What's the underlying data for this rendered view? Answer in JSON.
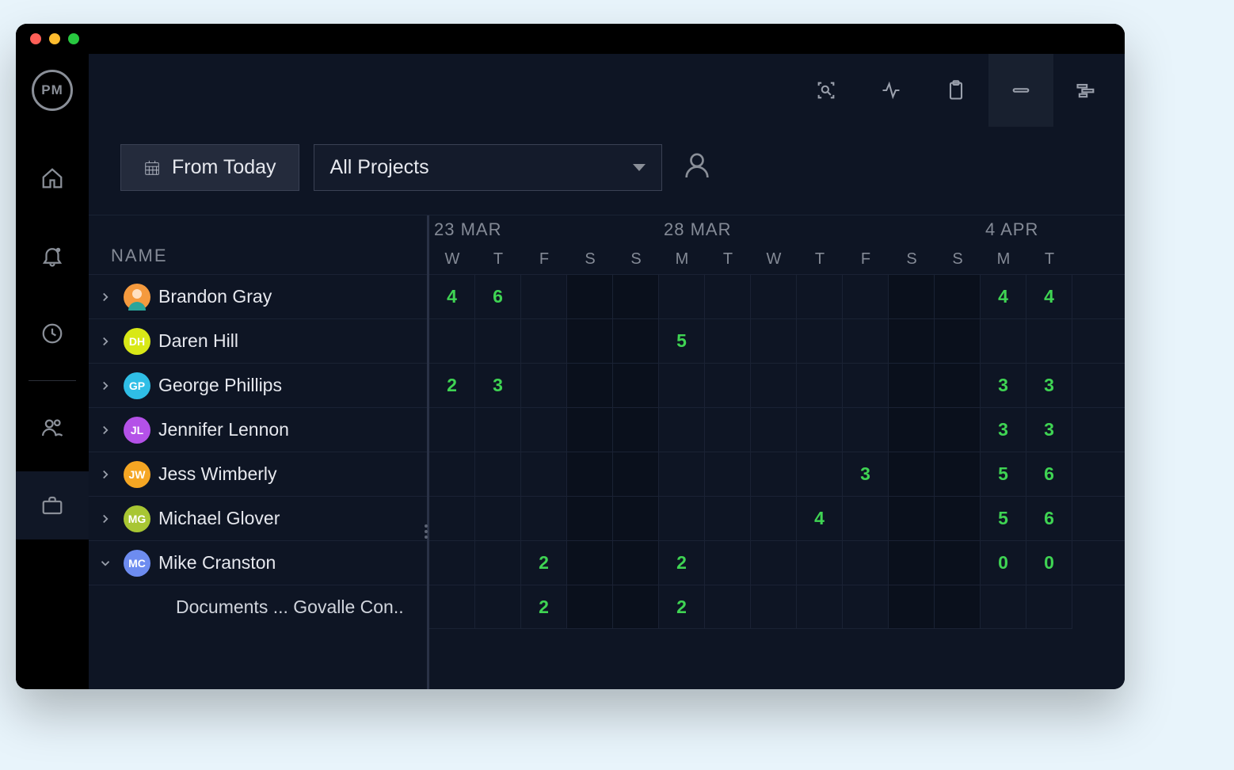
{
  "logo_text": "PM",
  "toolbar": {
    "from_today_label": "From Today",
    "projects_select_label": "All Projects"
  },
  "name_header": "NAME",
  "week_labels": [
    "23 MAR",
    "28 MAR",
    "4 APR"
  ],
  "week_spans": [
    5,
    7,
    2
  ],
  "days": [
    "W",
    "T",
    "F",
    "S",
    "S",
    "M",
    "T",
    "W",
    "T",
    "F",
    "S",
    "S",
    "M",
    "T"
  ],
  "weekend_idx": [
    3,
    4,
    10,
    11
  ],
  "people": [
    {
      "name": "Brandon Gray",
      "initials": "",
      "avatar_color": "#f59a3e",
      "avatar_img": true,
      "expanded": false,
      "cells": [
        "4",
        "6",
        "",
        "",
        "",
        "",
        "",
        "",
        "",
        "",
        "",
        "",
        "4",
        "4"
      ]
    },
    {
      "name": "Daren Hill",
      "initials": "DH",
      "avatar_color": "#d8e817",
      "avatar_img": false,
      "expanded": false,
      "cells": [
        "",
        "",
        "",
        "",
        "",
        "5",
        "",
        "",
        "",
        "",
        "",
        "",
        "",
        ""
      ]
    },
    {
      "name": "George Phillips",
      "initials": "GP",
      "avatar_color": "#2fbee6",
      "avatar_img": false,
      "expanded": false,
      "cells": [
        "2",
        "3",
        "",
        "",
        "",
        "",
        "",
        "",
        "",
        "",
        "",
        "",
        "3",
        "3"
      ]
    },
    {
      "name": "Jennifer Lennon",
      "initials": "JL",
      "avatar_color": "#b451e8",
      "avatar_img": false,
      "expanded": false,
      "cells": [
        "",
        "",
        "",
        "",
        "",
        "",
        "",
        "",
        "",
        "",
        "",
        "",
        "3",
        "3"
      ]
    },
    {
      "name": "Jess Wimberly",
      "initials": "JW",
      "avatar_color": "#f5a623",
      "avatar_img": false,
      "expanded": false,
      "cells": [
        "",
        "",
        "",
        "",
        "",
        "",
        "",
        "",
        "",
        "3",
        "",
        "",
        "5",
        "6"
      ]
    },
    {
      "name": "Michael Glover",
      "initials": "MG",
      "avatar_color": "#a8c633",
      "avatar_img": false,
      "expanded": false,
      "cells": [
        "",
        "",
        "",
        "",
        "",
        "",
        "",
        "",
        "4",
        "",
        "",
        "",
        "5",
        "6"
      ]
    },
    {
      "name": "Mike Cranston",
      "initials": "MC",
      "avatar_color": "#6d8cf0",
      "avatar_img": false,
      "expanded": true,
      "cells": [
        "",
        "",
        "2",
        "",
        "",
        "2",
        "",
        "",
        "",
        "",
        "",
        "",
        "0",
        "0"
      ]
    }
  ],
  "subtask": {
    "label": "Documents ...  Govalle Con..",
    "cells": [
      "",
      "",
      "2",
      "",
      "",
      "2",
      "",
      "",
      "",
      "",
      "",
      "",
      "",
      ""
    ]
  }
}
